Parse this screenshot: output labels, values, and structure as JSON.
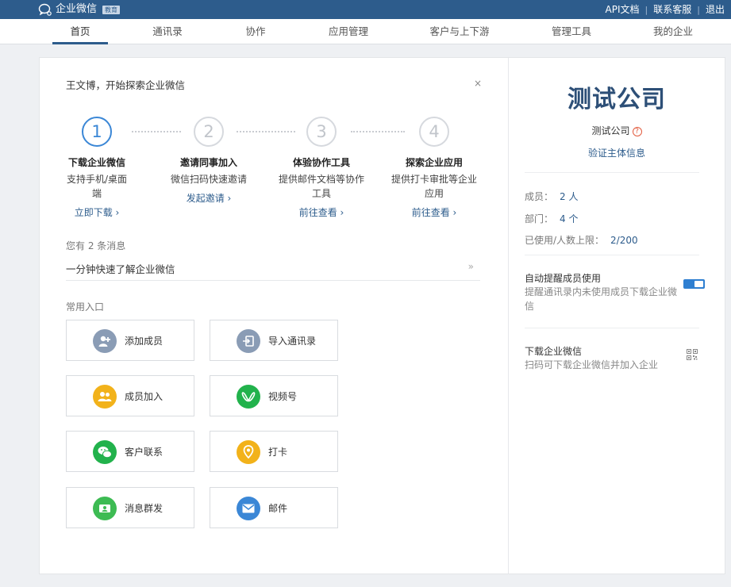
{
  "topbar": {
    "brand": "企业微信",
    "badge": "教育",
    "links": [
      "API文档",
      "联系客服",
      "退出"
    ]
  },
  "nav": {
    "items": [
      "首页",
      "通讯录",
      "协作",
      "应用管理",
      "客户与上下游",
      "管理工具",
      "我的企业"
    ],
    "active": "首页"
  },
  "welcome": {
    "greeting": "王文博，开始探索企业微信",
    "close": "×",
    "steps": [
      {
        "num": "1",
        "title": "下载企业微信",
        "desc_l1": "支持手机/桌面",
        "desc_l2": "端",
        "link": "立即下载 ›"
      },
      {
        "num": "2",
        "title": "邀请同事加入",
        "desc_l1": "微信扫码快速邀请",
        "desc_l2": "",
        "link": "发起邀请 ›"
      },
      {
        "num": "3",
        "title": "体验协作工具",
        "desc_l1": "提供邮件文档等协作",
        "desc_l2": "工具",
        "link": "前往查看 ›"
      },
      {
        "num": "4",
        "title": "探索企业应用",
        "desc_l1": "提供打卡审批等企业",
        "desc_l2": "应用",
        "link": "前往查看 ›"
      }
    ]
  },
  "messages": {
    "count": "您有 2 条消息",
    "first": "一分钟快速了解企业微信",
    "arrow": "»"
  },
  "entries": {
    "heading": "常用入口",
    "items": [
      {
        "label": "添加成员",
        "icon": "add-member-icon",
        "color": "#8a9cb5"
      },
      {
        "label": "导入通讯录",
        "icon": "import-contacts-icon",
        "color": "#8a9cb5"
      },
      {
        "label": "成员加入",
        "icon": "members-join-icon",
        "color": "#f2b21a"
      },
      {
        "label": "视频号",
        "icon": "channels-icon",
        "color": "#22b24c"
      },
      {
        "label": "客户联系",
        "icon": "wechat-icon",
        "color": "#22b24c"
      },
      {
        "label": "打卡",
        "icon": "location-icon",
        "color": "#f2b21a"
      },
      {
        "label": "消息群发",
        "icon": "broadcast-icon",
        "color": "#3dbb53"
      },
      {
        "label": "邮件",
        "icon": "mail-icon",
        "color": "#3b87d6"
      }
    ]
  },
  "company": {
    "display": "测试公司",
    "name": "测试公司",
    "help": "?",
    "verify": "验证主体信息",
    "stats": [
      {
        "label": "成员：",
        "value": "2 人"
      },
      {
        "label": "部门：",
        "value": "4 个"
      },
      {
        "label": "已使用/人数上限：",
        "value": "2/200"
      }
    ],
    "auto_remind": {
      "title": "自动提醒成员使用",
      "desc": "提醒通讯录内未使用成员下载企业微信",
      "enabled": true
    },
    "download": {
      "title": "下载企业微信",
      "desc": "扫码可下载企业微信并加入企业"
    }
  },
  "colors": {
    "brand": "#2d5c8c",
    "accent": "#3b87d6",
    "toggle": "#2f7fd1"
  }
}
